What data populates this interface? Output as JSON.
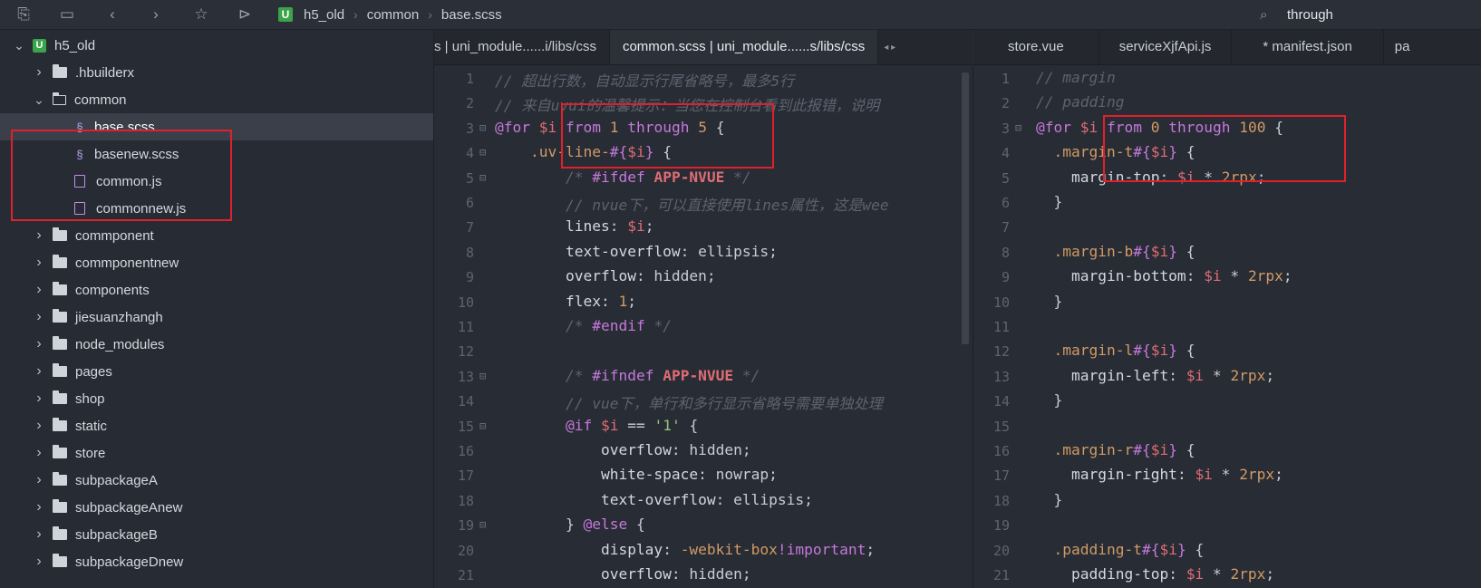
{
  "toolbar": {
    "icons": [
      "new-file-icon",
      "save-icon",
      "back-icon",
      "forward-icon",
      "star-icon",
      "run-icon"
    ]
  },
  "breadcrumb": {
    "badge": "U",
    "items": [
      "h5_old",
      "common",
      "base.scss"
    ],
    "sep": "›"
  },
  "search": {
    "value": "through"
  },
  "sidebar": {
    "items": [
      {
        "label": "h5_old",
        "kind": "project",
        "chev": "v",
        "indent": 0
      },
      {
        "label": ".hbuilderx",
        "kind": "folder",
        "chev": ">",
        "indent": 1
      },
      {
        "label": "common",
        "kind": "folder-open",
        "chev": "v",
        "indent": 1
      },
      {
        "label": "base.scss",
        "kind": "scss",
        "chev": "",
        "indent": 2,
        "selected": true
      },
      {
        "label": "basenew.scss",
        "kind": "scss",
        "chev": "",
        "indent": 2
      },
      {
        "label": "common.js",
        "kind": "js",
        "chev": "",
        "indent": 2
      },
      {
        "label": "commonnew.js",
        "kind": "js",
        "chev": "",
        "indent": 2
      },
      {
        "label": "commponent",
        "kind": "folder",
        "chev": ">",
        "indent": 1
      },
      {
        "label": "commponentnew",
        "kind": "folder",
        "chev": ">",
        "indent": 1
      },
      {
        "label": "components",
        "kind": "folder",
        "chev": ">",
        "indent": 1
      },
      {
        "label": "jiesuanzhangh",
        "kind": "folder",
        "chev": ">",
        "indent": 1
      },
      {
        "label": "node_modules",
        "kind": "folder",
        "chev": ">",
        "indent": 1
      },
      {
        "label": "pages",
        "kind": "folder",
        "chev": ">",
        "indent": 1
      },
      {
        "label": "shop",
        "kind": "folder",
        "chev": ">",
        "indent": 1
      },
      {
        "label": "static",
        "kind": "folder",
        "chev": ">",
        "indent": 1
      },
      {
        "label": "store",
        "kind": "folder",
        "chev": ">",
        "indent": 1
      },
      {
        "label": "subpackageA",
        "kind": "folder",
        "chev": ">",
        "indent": 1
      },
      {
        "label": "subpackageAnew",
        "kind": "folder",
        "chev": ">",
        "indent": 1
      },
      {
        "label": "subpackageB",
        "kind": "folder",
        "chev": ">",
        "indent": 1
      },
      {
        "label": "subpackageDnew",
        "kind": "folder",
        "chev": ">",
        "indent": 1
      }
    ]
  },
  "tabs_left": [
    "s | uni_module......i/libs/css",
    "common.scss | uni_module......s/libs/css"
  ],
  "tabs_right": [
    "store.vue",
    "serviceXjfApi.js",
    "* manifest.json",
    "pa"
  ],
  "left_code": [
    [
      [
        "c-com",
        "// 超出行数，自动显示行尾省略号，最多5行"
      ]
    ],
    [
      [
        "c-com",
        "// 来自uvui的温馨提示：当您在控制台看到此报错，说明"
      ]
    ],
    [
      [
        "c-kw",
        "@for"
      ],
      [
        "c-pun",
        " "
      ],
      [
        "c-var",
        "$i"
      ],
      [
        "c-pun",
        " "
      ],
      [
        "c-kw",
        "from"
      ],
      [
        "c-pun",
        " "
      ],
      [
        "c-num",
        "1"
      ],
      [
        "c-pun",
        " "
      ],
      [
        "c-kw",
        "through"
      ],
      [
        "c-pun",
        " "
      ],
      [
        "c-num",
        "5"
      ],
      [
        "c-pun",
        " {"
      ]
    ],
    [
      [
        "c-pun",
        "    "
      ],
      [
        "c-sel",
        ".uv-line-"
      ],
      [
        "c-kw",
        "#{"
      ],
      [
        "c-var",
        "$i"
      ],
      [
        "c-kw",
        "}"
      ],
      [
        "c-pun",
        " {"
      ]
    ],
    [
      [
        "c-pun",
        "        "
      ],
      [
        "c-com",
        "/* "
      ],
      [
        "c-kw",
        "#ifdef"
      ],
      [
        "c-pun",
        " "
      ],
      [
        "c-bold",
        "APP-NVUE"
      ],
      [
        "c-com",
        " */"
      ]
    ],
    [
      [
        "c-pun",
        "        "
      ],
      [
        "c-com",
        "// nvue下，可以直接使用lines属性，这是wee"
      ]
    ],
    [
      [
        "c-pun",
        "        "
      ],
      [
        "c-prop",
        "lines"
      ],
      [
        "c-pun",
        ": "
      ],
      [
        "c-var",
        "$i"
      ],
      [
        "c-pun",
        ";"
      ]
    ],
    [
      [
        "c-pun",
        "        "
      ],
      [
        "c-prop",
        "text-overflow"
      ],
      [
        "c-pun",
        ": ellipsis;"
      ]
    ],
    [
      [
        "c-pun",
        "        "
      ],
      [
        "c-prop",
        "overflow"
      ],
      [
        "c-pun",
        ": hidden;"
      ]
    ],
    [
      [
        "c-pun",
        "        "
      ],
      [
        "c-prop",
        "flex"
      ],
      [
        "c-pun",
        ": "
      ],
      [
        "c-num",
        "1"
      ],
      [
        "c-pun",
        ";"
      ]
    ],
    [
      [
        "c-pun",
        "        "
      ],
      [
        "c-com",
        "/* "
      ],
      [
        "c-kw",
        "#endif"
      ],
      [
        "c-com",
        " */"
      ]
    ],
    [],
    [
      [
        "c-pun",
        "        "
      ],
      [
        "c-com",
        "/* "
      ],
      [
        "c-kw",
        "#ifndef"
      ],
      [
        "c-pun",
        " "
      ],
      [
        "c-bold",
        "APP-NVUE"
      ],
      [
        "c-com",
        " */"
      ]
    ],
    [
      [
        "c-pun",
        "        "
      ],
      [
        "c-com",
        "// vue下，单行和多行显示省略号需要单独处理"
      ]
    ],
    [
      [
        "c-pun",
        "        "
      ],
      [
        "c-kw",
        "@if"
      ],
      [
        "c-pun",
        " "
      ],
      [
        "c-var",
        "$i"
      ],
      [
        "c-pun",
        " == "
      ],
      [
        "c-str",
        "'1'"
      ],
      [
        "c-pun",
        " {"
      ]
    ],
    [
      [
        "c-pun",
        "            "
      ],
      [
        "c-prop",
        "overflow"
      ],
      [
        "c-pun",
        ": hidden;"
      ]
    ],
    [
      [
        "c-pun",
        "            "
      ],
      [
        "c-prop",
        "white-space"
      ],
      [
        "c-pun",
        ": nowrap;"
      ]
    ],
    [
      [
        "c-pun",
        "            "
      ],
      [
        "c-prop",
        "text-overflow"
      ],
      [
        "c-pun",
        ": ellipsis;"
      ]
    ],
    [
      [
        "c-pun",
        "        } "
      ],
      [
        "c-kw",
        "@else"
      ],
      [
        "c-pun",
        " {"
      ]
    ],
    [
      [
        "c-pun",
        "            "
      ],
      [
        "c-prop",
        "display"
      ],
      [
        "c-pun",
        ": "
      ],
      [
        "c-num",
        "-webkit-box"
      ],
      [
        "c-imp",
        "!important"
      ],
      [
        "c-pun",
        ";"
      ]
    ],
    [
      [
        "c-pun",
        "            "
      ],
      [
        "c-prop",
        "overflow"
      ],
      [
        "c-pun",
        ": hidden;"
      ]
    ]
  ],
  "left_folds": [
    3,
    4,
    5,
    13,
    15,
    19
  ],
  "right_code": [
    [
      [
        "c-com",
        "// margin"
      ]
    ],
    [
      [
        "c-com",
        "// padding"
      ]
    ],
    [
      [
        "c-kw",
        "@for"
      ],
      [
        "c-pun",
        " "
      ],
      [
        "c-var",
        "$i"
      ],
      [
        "c-pun",
        " "
      ],
      [
        "c-kw",
        "from"
      ],
      [
        "c-pun",
        " "
      ],
      [
        "c-num",
        "0"
      ],
      [
        "c-pun",
        " "
      ],
      [
        "c-kw",
        "through"
      ],
      [
        "c-pun",
        " "
      ],
      [
        "c-num",
        "100"
      ],
      [
        "c-pun",
        " {"
      ]
    ],
    [
      [
        "c-pun",
        "  "
      ],
      [
        "c-sel",
        ".margin-t"
      ],
      [
        "c-kw",
        "#{"
      ],
      [
        "c-var",
        "$i"
      ],
      [
        "c-kw",
        "}"
      ],
      [
        "c-pun",
        " {"
      ]
    ],
    [
      [
        "c-pun",
        "    "
      ],
      [
        "c-prop",
        "margin-top"
      ],
      [
        "c-pun",
        ": "
      ],
      [
        "c-var",
        "$i"
      ],
      [
        "c-pun",
        " * "
      ],
      [
        "c-num",
        "2rpx"
      ],
      [
        "c-pun",
        ";"
      ]
    ],
    [
      [
        "c-pun",
        "  }"
      ]
    ],
    [],
    [
      [
        "c-pun",
        "  "
      ],
      [
        "c-sel",
        ".margin-b"
      ],
      [
        "c-kw",
        "#{"
      ],
      [
        "c-var",
        "$i"
      ],
      [
        "c-kw",
        "}"
      ],
      [
        "c-pun",
        " {"
      ]
    ],
    [
      [
        "c-pun",
        "    "
      ],
      [
        "c-prop",
        "margin-bottom"
      ],
      [
        "c-pun",
        ": "
      ],
      [
        "c-var",
        "$i"
      ],
      [
        "c-pun",
        " * "
      ],
      [
        "c-num",
        "2rpx"
      ],
      [
        "c-pun",
        ";"
      ]
    ],
    [
      [
        "c-pun",
        "  }"
      ]
    ],
    [],
    [
      [
        "c-pun",
        "  "
      ],
      [
        "c-sel",
        ".margin-l"
      ],
      [
        "c-kw",
        "#{"
      ],
      [
        "c-var",
        "$i"
      ],
      [
        "c-kw",
        "}"
      ],
      [
        "c-pun",
        " {"
      ]
    ],
    [
      [
        "c-pun",
        "    "
      ],
      [
        "c-prop",
        "margin-left"
      ],
      [
        "c-pun",
        ": "
      ],
      [
        "c-var",
        "$i"
      ],
      [
        "c-pun",
        " * "
      ],
      [
        "c-num",
        "2rpx"
      ],
      [
        "c-pun",
        ";"
      ]
    ],
    [
      [
        "c-pun",
        "  }"
      ]
    ],
    [],
    [
      [
        "c-pun",
        "  "
      ],
      [
        "c-sel",
        ".margin-r"
      ],
      [
        "c-kw",
        "#{"
      ],
      [
        "c-var",
        "$i"
      ],
      [
        "c-kw",
        "}"
      ],
      [
        "c-pun",
        " {"
      ]
    ],
    [
      [
        "c-pun",
        "    "
      ],
      [
        "c-prop",
        "margin-right"
      ],
      [
        "c-pun",
        ": "
      ],
      [
        "c-var",
        "$i"
      ],
      [
        "c-pun",
        " * "
      ],
      [
        "c-num",
        "2rpx"
      ],
      [
        "c-pun",
        ";"
      ]
    ],
    [
      [
        "c-pun",
        "  }"
      ]
    ],
    [],
    [
      [
        "c-pun",
        "  "
      ],
      [
        "c-sel",
        ".padding-t"
      ],
      [
        "c-kw",
        "#{"
      ],
      [
        "c-var",
        "$i"
      ],
      [
        "c-kw",
        "}"
      ],
      [
        "c-pun",
        " {"
      ]
    ],
    [
      [
        "c-pun",
        "    "
      ],
      [
        "c-prop",
        "padding-top"
      ],
      [
        "c-pun",
        ": "
      ],
      [
        "c-var",
        "$i"
      ],
      [
        "c-pun",
        " * "
      ],
      [
        "c-num",
        "2rpx"
      ],
      [
        "c-pun",
        ";"
      ]
    ]
  ],
  "right_folds": [
    3
  ],
  "colors": {
    "annotation": "#e0202a",
    "accent_green": "#3ba34a"
  }
}
